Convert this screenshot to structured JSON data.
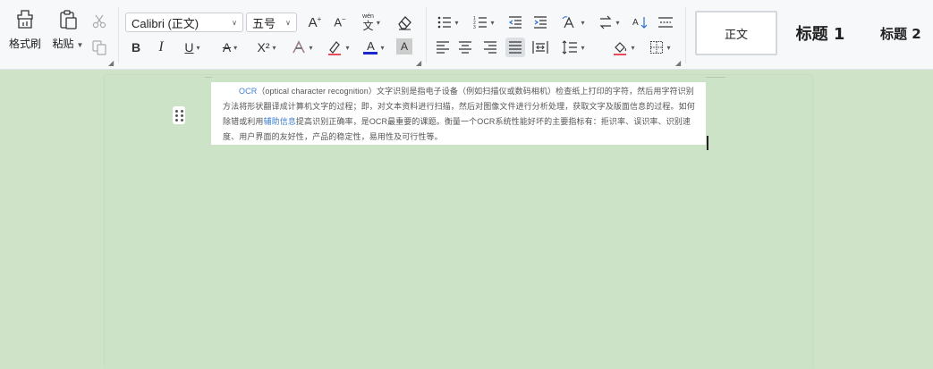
{
  "ribbon": {
    "clipboard": {
      "format_painter_label": "格式刷",
      "paste_label": "粘贴"
    },
    "font": {
      "family": "Calibri (正文)",
      "size": "五号",
      "bold": "B",
      "italic": "I",
      "underline": "U",
      "strikethrough": "A",
      "superscript": "X²",
      "font_color_letter": "A",
      "char_shading_letter": "A",
      "grow_letter": "A",
      "shrink_letter": "A",
      "phonetic": "wén",
      "font_color": "#1a27c9"
    },
    "styles": {
      "normal": "正文",
      "heading1": "标题 1",
      "heading2": "标题 2"
    }
  },
  "document": {
    "p_ocr": "OCR",
    "p_part1": "（optical character recognition）文字识别是指电子设备（例如扫描仪或数码相机）检查纸上打印的字符，然后用字符识别方法将形状翻译成计算机文字的过程；即，对文本资料进行扫描，然后对图像文件进行分析处理，获取文字及版面信息的过程。如何除错或利用",
    "p_link": "辅助信息",
    "p_part2": "提高识别正确率，是OCR最重要的课题。衡量一个OCR系统性能好坏的主要指标有：拒识率、误识率、识别速度、用户界面的友好性，产品的稳定性，易用性及可行性等。"
  }
}
